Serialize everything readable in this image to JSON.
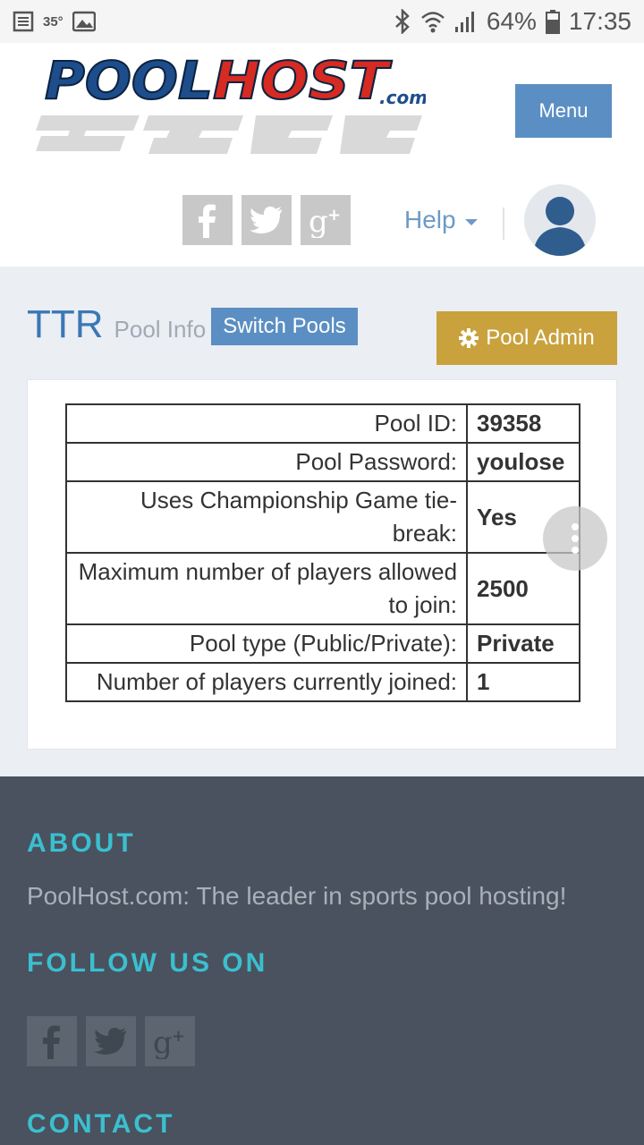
{
  "status_bar": {
    "temperature": "35°",
    "battery": "64%",
    "time": "17:35",
    "icons": [
      "news-icon",
      "image-icon",
      "bluetooth-icon",
      "wifi-icon",
      "signal-icon",
      "battery-icon"
    ]
  },
  "header": {
    "logo_text": "POOLHOST.com",
    "menu_label": "Menu",
    "social": [
      "facebook-icon",
      "twitter-icon",
      "google-plus-icon"
    ],
    "help_label": "Help"
  },
  "pool": {
    "name": "TTR",
    "section": "Pool Info",
    "switch_label": "Switch Pools",
    "admin_label": "Pool Admin"
  },
  "info_rows": [
    {
      "key": "Pool ID:",
      "value": "39358"
    },
    {
      "key": "Pool Password:",
      "value": "youlose"
    },
    {
      "key": "Uses Championship Game tie-break:",
      "value": "Yes"
    },
    {
      "key": "Maximum number of players allowed to join:",
      "value": "2500"
    },
    {
      "key": "Pool type (Public/Private):",
      "value": "Private"
    },
    {
      "key": "Number of players currently joined:",
      "value": "1"
    }
  ],
  "footer": {
    "about_heading": "ABOUT",
    "about_text": "PoolHost.com: The leader in sports pool hosting!",
    "follow_heading": "FOLLOW US ON",
    "contact_heading": "CONTACT"
  },
  "colors": {
    "accent_blue": "#5b8fc3",
    "admin_gold": "#c9a23d",
    "footer_bg": "#49525e",
    "footer_heading": "#3bbfd0"
  }
}
